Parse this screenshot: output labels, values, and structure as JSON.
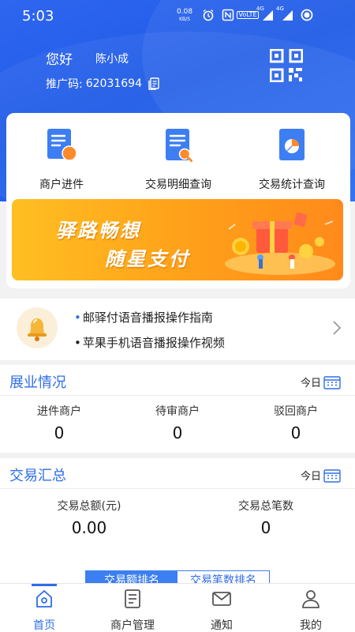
{
  "status_bar": {
    "time": "5:03",
    "net_speed_value": "0.08",
    "net_speed_unit": "KB/S",
    "volte_label": "VoLTE",
    "signal1_label": "4G",
    "signal2_label": "4G"
  },
  "header": {
    "greeting": "您好",
    "username": "陈小成",
    "promo_label": "推广码:",
    "promo_code": "62031694"
  },
  "functions": [
    {
      "label": "商户进件",
      "icon": "merchant-onboarding-icon"
    },
    {
      "label": "交易明细查询",
      "icon": "transaction-detail-icon"
    },
    {
      "label": "交易统计查询",
      "icon": "transaction-statistics-icon"
    }
  ],
  "banner": {
    "line1": "驿路畅想",
    "line2": "随星支付"
  },
  "notice": {
    "items": [
      "邮驿付语音播报操作指南",
      "苹果手机语音播报操作视频"
    ]
  },
  "business": {
    "title": "展业情况",
    "period": "今日",
    "stats": [
      {
        "label": "进件商户",
        "value": "0"
      },
      {
        "label": "待审商户",
        "value": "0"
      },
      {
        "label": "驳回商户",
        "value": "0"
      }
    ]
  },
  "trade": {
    "title": "交易汇总",
    "period": "今日",
    "stats": [
      {
        "label": "交易总额(元)",
        "value": "0.00"
      },
      {
        "label": "交易总笔数",
        "value": "0"
      }
    ],
    "rank_tabs": [
      "交易额排名",
      "交易笔数排名"
    ]
  },
  "tabbar": {
    "items": [
      {
        "label": "首页",
        "icon": "home-icon",
        "active": true
      },
      {
        "label": "商户管理",
        "icon": "merchant-management-icon",
        "active": false
      },
      {
        "label": "通知",
        "icon": "mail-icon",
        "active": false
      },
      {
        "label": "我的",
        "icon": "profile-icon",
        "active": false
      }
    ]
  },
  "colors": {
    "primary": "#2f6ee8",
    "header_bg": "#2462ea",
    "banner_orange": "#ffa21a"
  }
}
